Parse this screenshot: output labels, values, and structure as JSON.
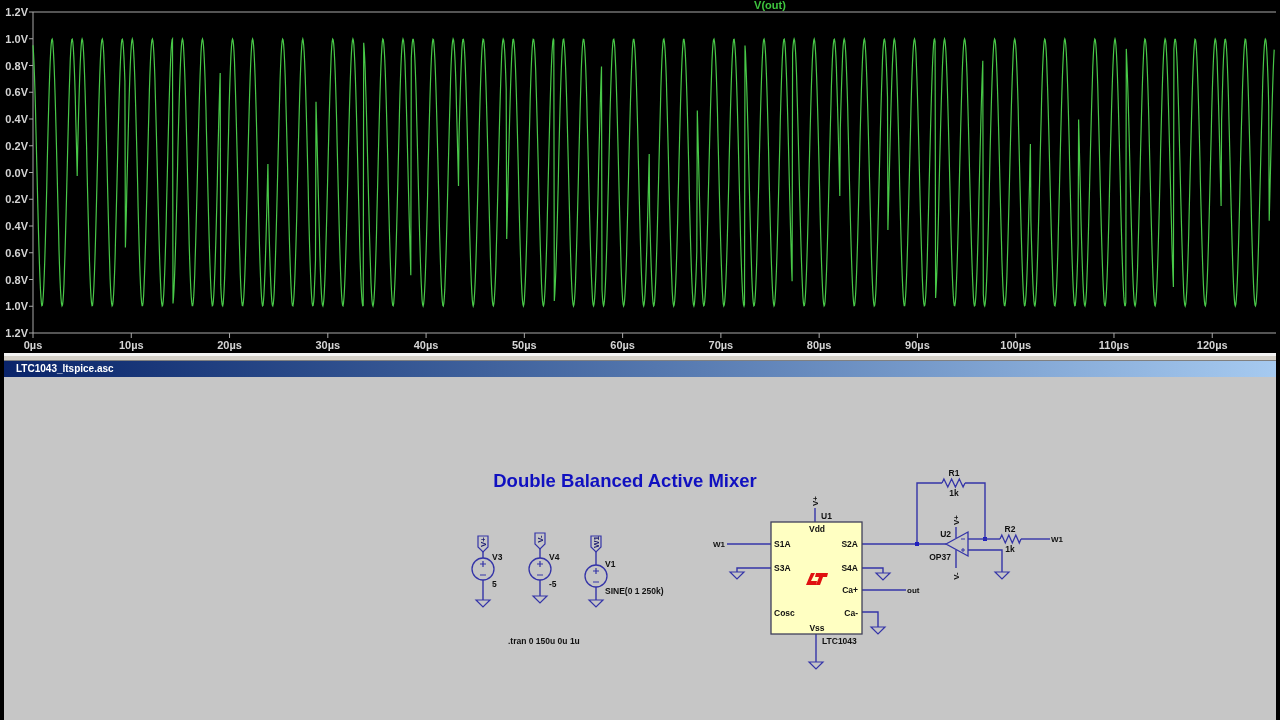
{
  "plot": {
    "trace_label": "V(out)",
    "y_tick_labels": [
      "1.2V",
      "1.0V",
      "0.8V",
      "0.6V",
      "0.4V",
      "0.2V",
      "0.0V",
      "0.2V",
      "0.4V",
      "0.6V",
      "0.8V",
      "1.0V",
      "1.2V"
    ],
    "x_tick_labels": [
      "0µs",
      "10µs",
      "20µs",
      "30µs",
      "40µs",
      "50µs",
      "60µs",
      "70µs",
      "80µs",
      "90µs",
      "100µs",
      "110µs",
      "120µs"
    ]
  },
  "schematic_window": {
    "title": "LTC1043_ltspice.asc"
  },
  "schematic": {
    "title": "Double Balanced Active Mixer",
    "sources": [
      {
        "name": "V3",
        "value": "5",
        "net": "V+"
      },
      {
        "name": "V4",
        "value": "-5",
        "net": "V-"
      },
      {
        "name": "V1",
        "value": "SINE(0 1 250k)",
        "net": "W1"
      }
    ],
    "directive": ".tran 0 150u 0u 1u",
    "mixer": {
      "name": "U1",
      "part": "LTC1043",
      "nets": [
        "V+",
        "W1",
        "out"
      ],
      "pins": [
        "Vdd",
        "S1A",
        "S2A",
        "S3A",
        "S4A",
        "Ca+",
        "Ca-",
        "Cosc",
        "Vss"
      ]
    },
    "opamp": {
      "name": "U2",
      "part": "OP37",
      "nets": [
        "V+",
        "V-"
      ]
    },
    "resistors": [
      {
        "name": "R1",
        "value": "1k"
      },
      {
        "name": "R2",
        "value": "1k",
        "net": "W1"
      }
    ]
  }
}
